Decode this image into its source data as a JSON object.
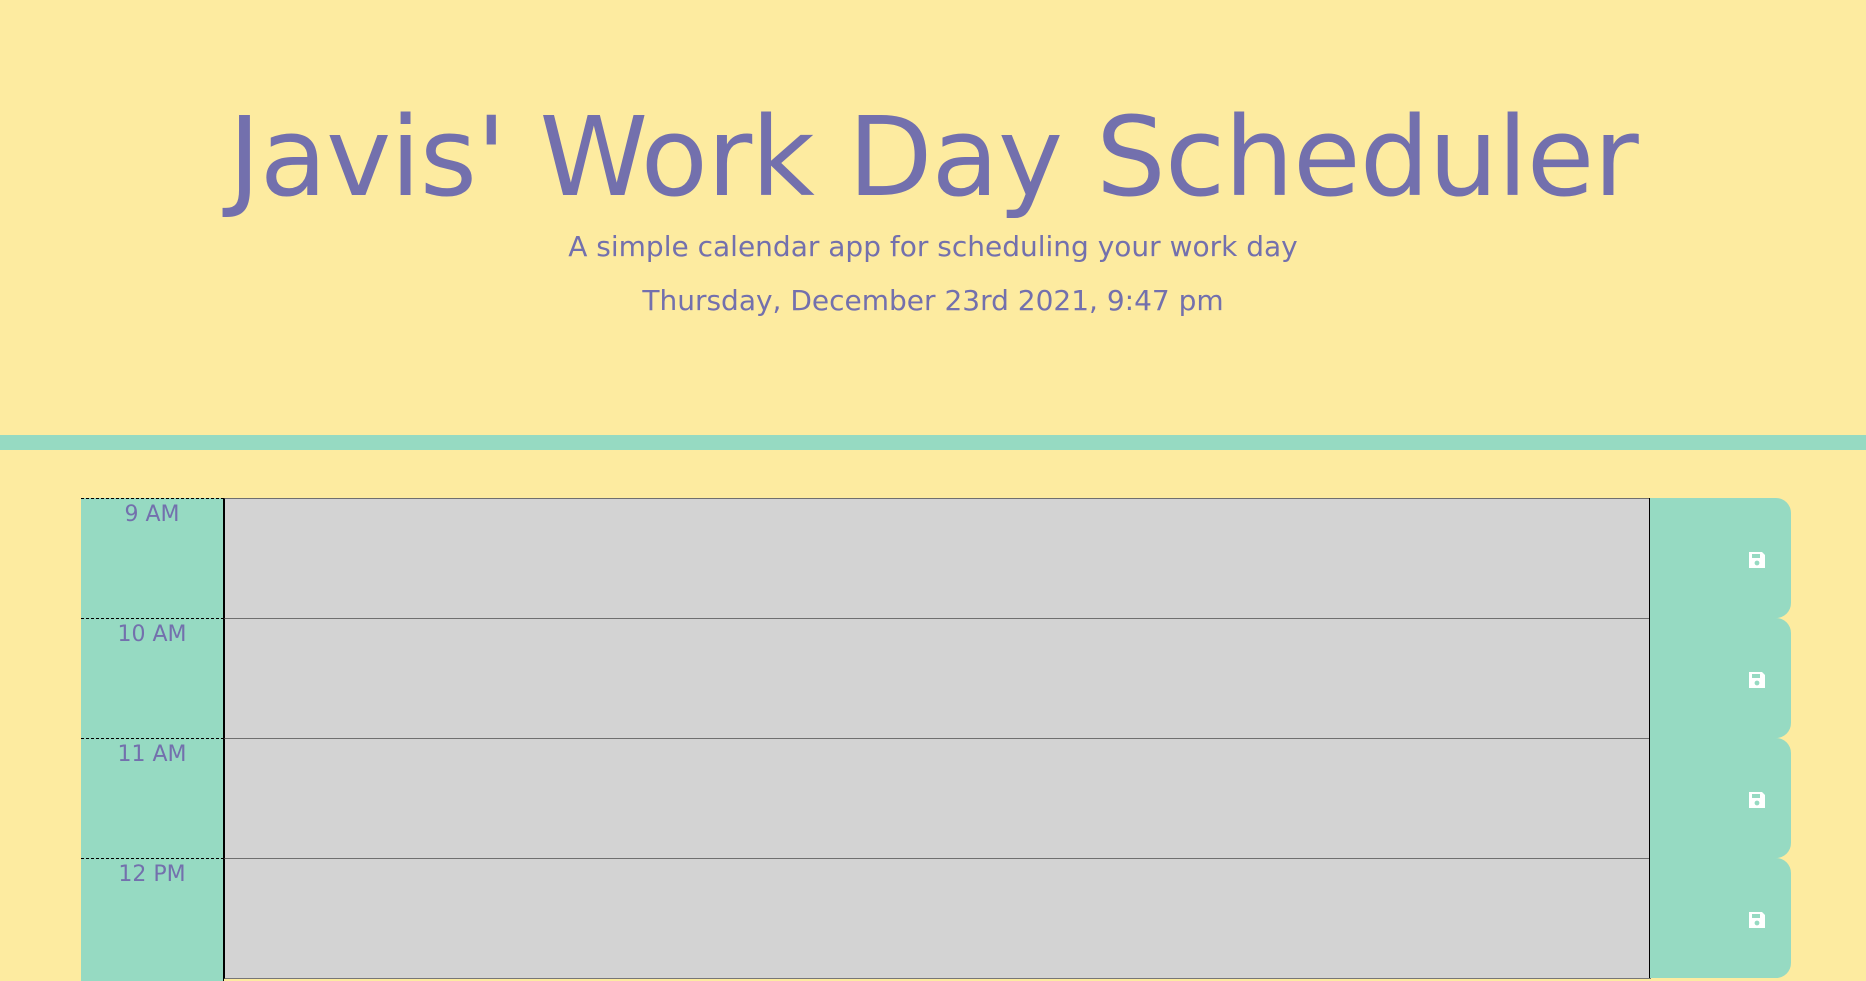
{
  "header": {
    "title": "Javis' Work Day Scheduler",
    "lead": "A simple calendar app for scheduling your work day",
    "current_date": "Thursday, December 23rd 2021, 9:47 pm"
  },
  "colors": {
    "background": "#fdeba0",
    "accent": "#96dac2",
    "text": "#7370ad",
    "past_block": "#d3d3d3"
  },
  "timeblocks": [
    {
      "hour": "9 AM",
      "description": "",
      "save_icon": "floppy-disk-icon"
    },
    {
      "hour": "10 AM",
      "description": "",
      "save_icon": "floppy-disk-icon"
    },
    {
      "hour": "11 AM",
      "description": "",
      "save_icon": "floppy-disk-icon"
    },
    {
      "hour": "12 PM",
      "description": "",
      "save_icon": "floppy-disk-icon"
    }
  ]
}
